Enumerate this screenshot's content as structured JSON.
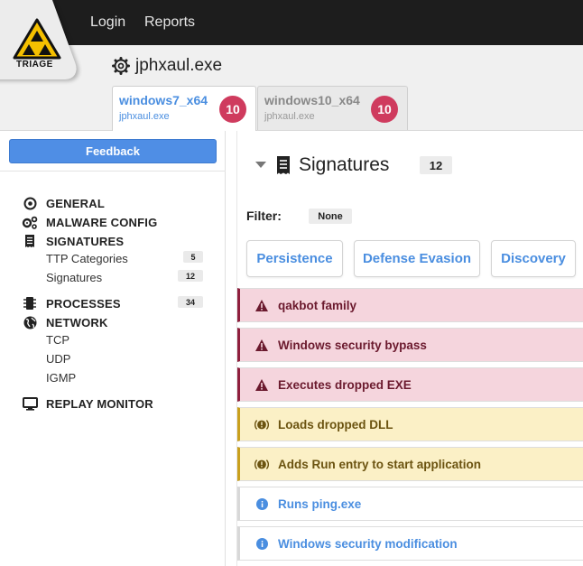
{
  "nav": {
    "login": "Login",
    "reports": "Reports"
  },
  "logo": {
    "text": "TRIAGE"
  },
  "header": {
    "filename": "jphxaul.exe",
    "tabs": [
      {
        "os": "windows7_x64",
        "file": "jphxaul.exe",
        "score": "10",
        "active": true
      },
      {
        "os": "windows10_x64",
        "file": "jphxaul.exe",
        "score": "10",
        "active": false
      }
    ]
  },
  "sidebar": {
    "feedback": "Feedback",
    "general": "GENERAL",
    "malware_config": "MALWARE CONFIG",
    "signatures": "SIGNATURES",
    "ttp_categories": "TTP Categories",
    "ttp_count": "5",
    "signatures_sub": "Signatures",
    "signatures_count": "12",
    "processes": "PROCESSES",
    "processes_count": "34",
    "network": "NETWORK",
    "tcp": "TCP",
    "udp": "UDP",
    "igmp": "IGMP",
    "replay_monitor": "REPLAY MONITOR"
  },
  "main": {
    "title": "Signatures",
    "count": "12",
    "filter_label": "Filter:",
    "filter_value": "None",
    "chips": [
      "Persistence",
      "Defense Evasion",
      "Discovery"
    ],
    "signatures": [
      {
        "label": "qakbot family",
        "severity": "red"
      },
      {
        "label": "Windows security bypass",
        "severity": "red"
      },
      {
        "label": "Executes dropped EXE",
        "severity": "red"
      },
      {
        "label": "Loads dropped DLL",
        "severity": "yellow"
      },
      {
        "label": "Adds Run entry to start application",
        "severity": "yellow"
      },
      {
        "label": "Runs ping.exe",
        "severity": "info"
      },
      {
        "label": "Windows security modification",
        "severity": "info"
      }
    ]
  },
  "colors": {
    "accent": "#4a8ee0",
    "score": "#cf3b5e",
    "danger": "#8f1f3d",
    "warning": "#c9a01d"
  }
}
